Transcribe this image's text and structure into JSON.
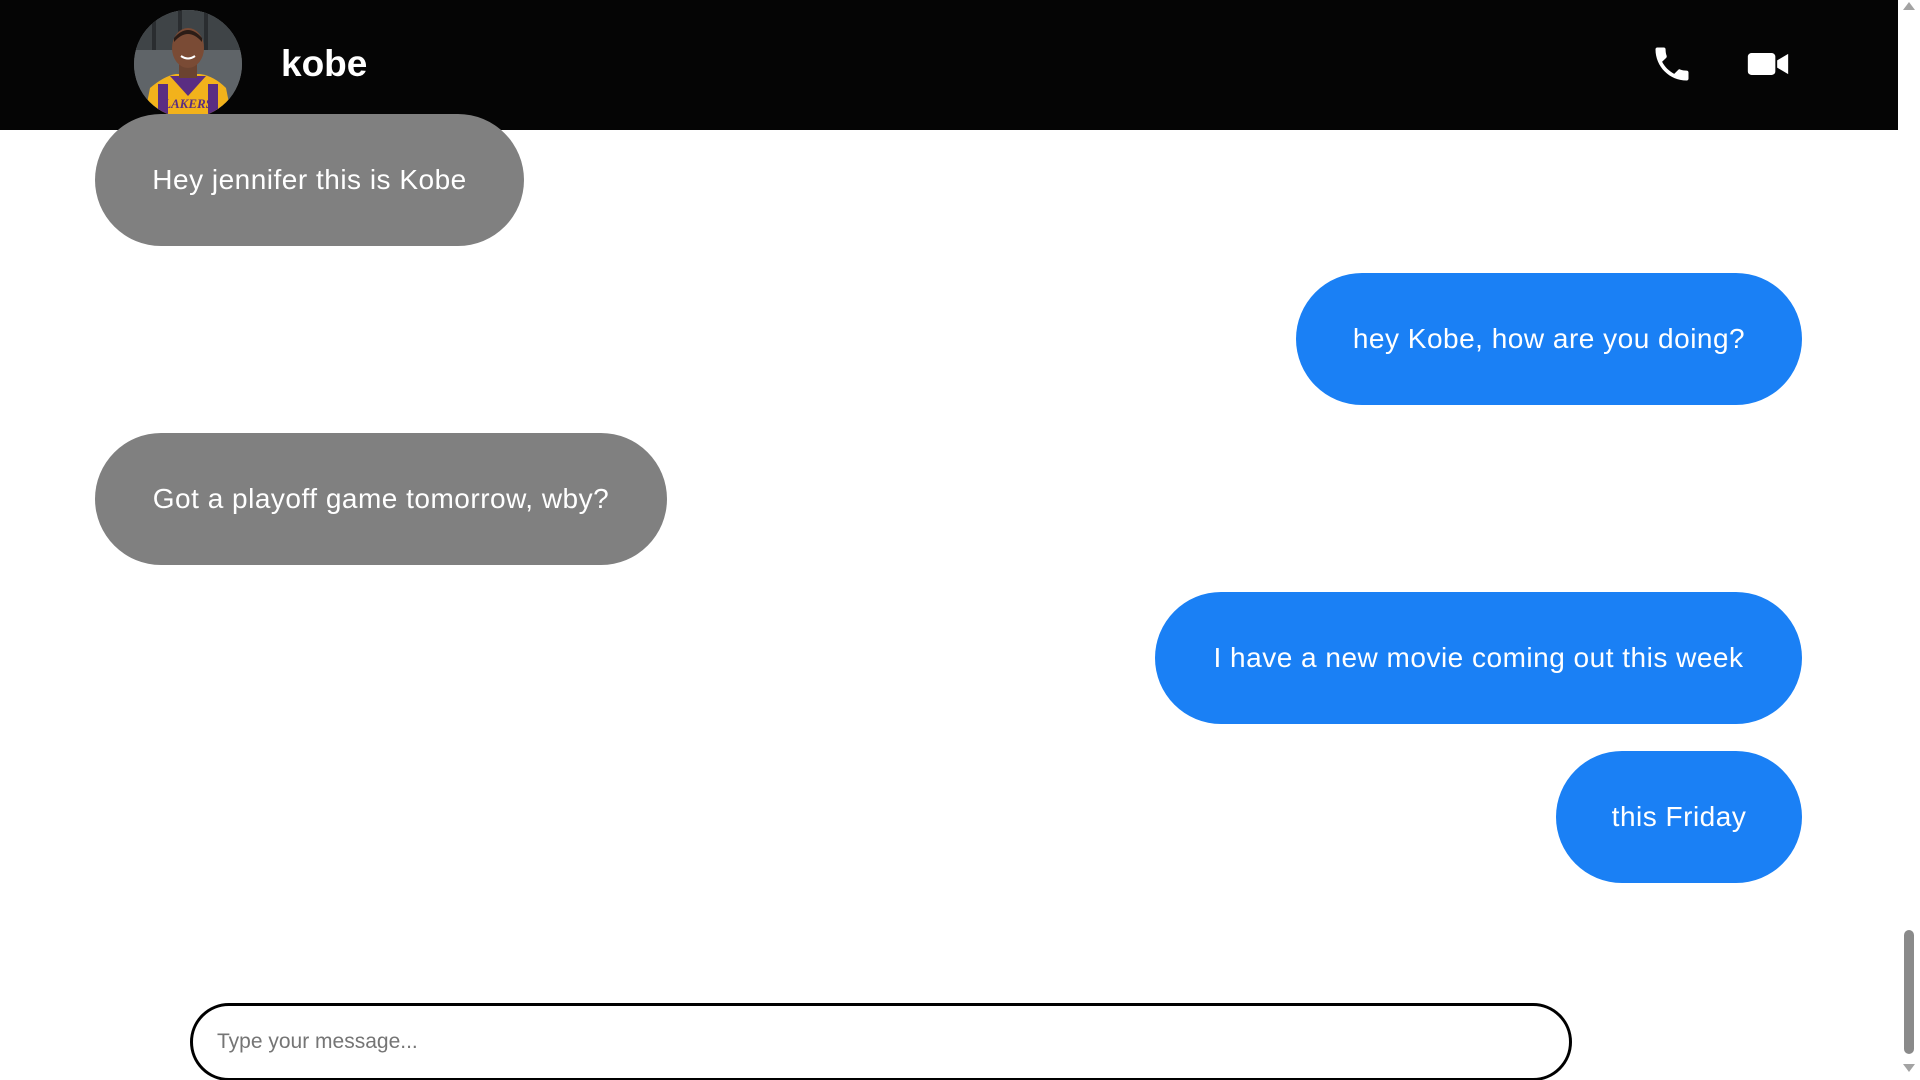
{
  "header": {
    "contact_name": "kobe",
    "avatar_alt": "kobe avatar",
    "icons": {
      "phone": "phone-icon",
      "video": "video-camera-icon"
    }
  },
  "messages": [
    {
      "direction": "received",
      "text": "Hey jennifer this is Kobe"
    },
    {
      "direction": "sent",
      "text": "hey Kobe, how are you doing?"
    },
    {
      "direction": "received",
      "text": "Got a playoff game tomorrow, wby?"
    },
    {
      "direction": "sent",
      "text": "I have a new movie coming out this week"
    },
    {
      "direction": "sent",
      "text": "this Friday"
    }
  ],
  "composer": {
    "value": "",
    "placeholder": "Type your message..."
  },
  "colors": {
    "header_bg": "#050505",
    "received_bubble": "#808080",
    "sent_bubble": "#1a80f5",
    "text_on_bubble": "#ffffff"
  }
}
